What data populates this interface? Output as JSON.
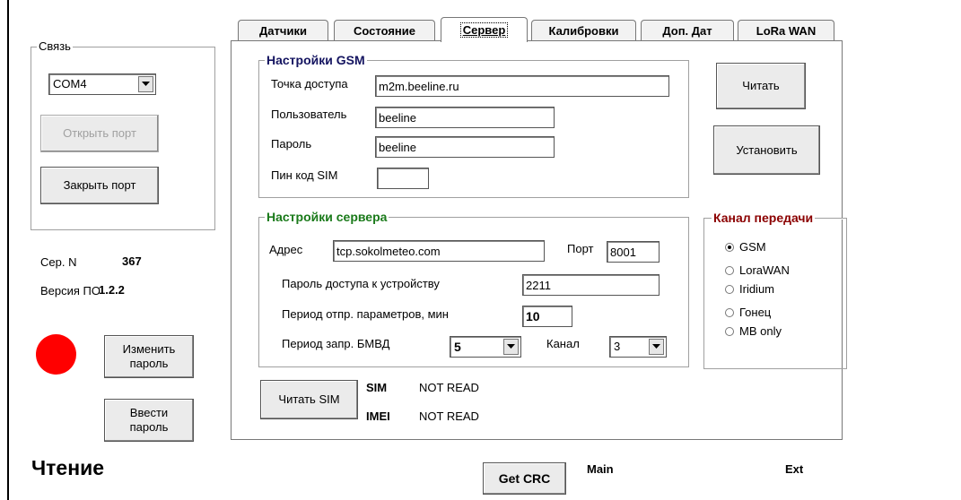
{
  "tabs": [
    "Датчики",
    "Состояние",
    "Сервер",
    "Калибровки",
    "Доп. Дат",
    "LoRa WAN"
  ],
  "left": {
    "comm_group_title": "Связь",
    "port_value": "COM4",
    "open_port": "Открыть порт",
    "close_port": "Закрыть порт",
    "serial_label": "Сер. N",
    "serial_value": "367",
    "version_label": "Версия ПО",
    "version_value": "1.2.2",
    "status_color": "#ff0000",
    "change_password": [
      "Изменить",
      "пароль"
    ],
    "enter_password": [
      "Ввести",
      "пароль"
    ],
    "status_text": "Чтение"
  },
  "gsm": {
    "title": "Настройки GSM",
    "apn_label": "Точка доступа",
    "apn_value": "m2m.beeline.ru",
    "user_label": "Пользователь",
    "user_value": "beeline",
    "password_label": "Пароль",
    "password_value": "beeline",
    "pin_label": "Пин код SIM",
    "pin_value": ""
  },
  "actions": {
    "read": "Читать",
    "set": "Установить"
  },
  "server": {
    "title": "Настройки сервера",
    "address_label": "Адрес",
    "address_value": "tcp.sokolmeteo.com",
    "port_label": "Порт",
    "port_value": "8001",
    "device_password_label": "Пароль доступа к устройству",
    "device_password_value": "2211",
    "send_period_label": "Период отпр. параметров, мин",
    "send_period_value": "10",
    "poll_period_label": "Период запр. БМВД",
    "poll_period_value": "5",
    "channel_label": "Канал",
    "channel_value": "3"
  },
  "channel": {
    "title": "Канал передачи",
    "options": [
      "GSM",
      "LoraWAN",
      "Iridium",
      "Гонец",
      "MB only"
    ],
    "selected": "GSM"
  },
  "sim": {
    "read_sim": "Читать SIM",
    "sim_label": "SIM",
    "sim_value": "NOT READ",
    "imei_label": "IMEI",
    "imei_value": "NOT READ"
  },
  "bottom": {
    "get_crc": "Get CRC",
    "main_label": "Main",
    "ext_label": "Ext"
  }
}
